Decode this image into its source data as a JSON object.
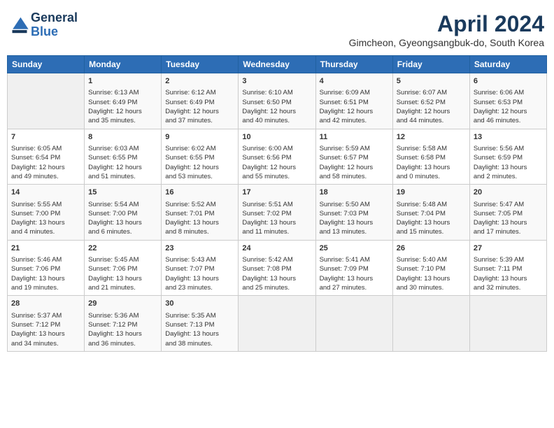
{
  "logo": {
    "line1": "General",
    "line2": "Blue"
  },
  "title": "April 2024",
  "subtitle": "Gimcheon, Gyeongsangbuk-do, South Korea",
  "days_of_week": [
    "Sunday",
    "Monday",
    "Tuesday",
    "Wednesday",
    "Thursday",
    "Friday",
    "Saturday"
  ],
  "weeks": [
    [
      {
        "day": "",
        "info": ""
      },
      {
        "day": "1",
        "info": "Sunrise: 6:13 AM\nSunset: 6:49 PM\nDaylight: 12 hours\nand 35 minutes."
      },
      {
        "day": "2",
        "info": "Sunrise: 6:12 AM\nSunset: 6:49 PM\nDaylight: 12 hours\nand 37 minutes."
      },
      {
        "day": "3",
        "info": "Sunrise: 6:10 AM\nSunset: 6:50 PM\nDaylight: 12 hours\nand 40 minutes."
      },
      {
        "day": "4",
        "info": "Sunrise: 6:09 AM\nSunset: 6:51 PM\nDaylight: 12 hours\nand 42 minutes."
      },
      {
        "day": "5",
        "info": "Sunrise: 6:07 AM\nSunset: 6:52 PM\nDaylight: 12 hours\nand 44 minutes."
      },
      {
        "day": "6",
        "info": "Sunrise: 6:06 AM\nSunset: 6:53 PM\nDaylight: 12 hours\nand 46 minutes."
      }
    ],
    [
      {
        "day": "7",
        "info": "Sunrise: 6:05 AM\nSunset: 6:54 PM\nDaylight: 12 hours\nand 49 minutes."
      },
      {
        "day": "8",
        "info": "Sunrise: 6:03 AM\nSunset: 6:55 PM\nDaylight: 12 hours\nand 51 minutes."
      },
      {
        "day": "9",
        "info": "Sunrise: 6:02 AM\nSunset: 6:55 PM\nDaylight: 12 hours\nand 53 minutes."
      },
      {
        "day": "10",
        "info": "Sunrise: 6:00 AM\nSunset: 6:56 PM\nDaylight: 12 hours\nand 55 minutes."
      },
      {
        "day": "11",
        "info": "Sunrise: 5:59 AM\nSunset: 6:57 PM\nDaylight: 12 hours\nand 58 minutes."
      },
      {
        "day": "12",
        "info": "Sunrise: 5:58 AM\nSunset: 6:58 PM\nDaylight: 13 hours\nand 0 minutes."
      },
      {
        "day": "13",
        "info": "Sunrise: 5:56 AM\nSunset: 6:59 PM\nDaylight: 13 hours\nand 2 minutes."
      }
    ],
    [
      {
        "day": "14",
        "info": "Sunrise: 5:55 AM\nSunset: 7:00 PM\nDaylight: 13 hours\nand 4 minutes."
      },
      {
        "day": "15",
        "info": "Sunrise: 5:54 AM\nSunset: 7:00 PM\nDaylight: 13 hours\nand 6 minutes."
      },
      {
        "day": "16",
        "info": "Sunrise: 5:52 AM\nSunset: 7:01 PM\nDaylight: 13 hours\nand 8 minutes."
      },
      {
        "day": "17",
        "info": "Sunrise: 5:51 AM\nSunset: 7:02 PM\nDaylight: 13 hours\nand 11 minutes."
      },
      {
        "day": "18",
        "info": "Sunrise: 5:50 AM\nSunset: 7:03 PM\nDaylight: 13 hours\nand 13 minutes."
      },
      {
        "day": "19",
        "info": "Sunrise: 5:48 AM\nSunset: 7:04 PM\nDaylight: 13 hours\nand 15 minutes."
      },
      {
        "day": "20",
        "info": "Sunrise: 5:47 AM\nSunset: 7:05 PM\nDaylight: 13 hours\nand 17 minutes."
      }
    ],
    [
      {
        "day": "21",
        "info": "Sunrise: 5:46 AM\nSunset: 7:06 PM\nDaylight: 13 hours\nand 19 minutes."
      },
      {
        "day": "22",
        "info": "Sunrise: 5:45 AM\nSunset: 7:06 PM\nDaylight: 13 hours\nand 21 minutes."
      },
      {
        "day": "23",
        "info": "Sunrise: 5:43 AM\nSunset: 7:07 PM\nDaylight: 13 hours\nand 23 minutes."
      },
      {
        "day": "24",
        "info": "Sunrise: 5:42 AM\nSunset: 7:08 PM\nDaylight: 13 hours\nand 25 minutes."
      },
      {
        "day": "25",
        "info": "Sunrise: 5:41 AM\nSunset: 7:09 PM\nDaylight: 13 hours\nand 27 minutes."
      },
      {
        "day": "26",
        "info": "Sunrise: 5:40 AM\nSunset: 7:10 PM\nDaylight: 13 hours\nand 30 minutes."
      },
      {
        "day": "27",
        "info": "Sunrise: 5:39 AM\nSunset: 7:11 PM\nDaylight: 13 hours\nand 32 minutes."
      }
    ],
    [
      {
        "day": "28",
        "info": "Sunrise: 5:37 AM\nSunset: 7:12 PM\nDaylight: 13 hours\nand 34 minutes."
      },
      {
        "day": "29",
        "info": "Sunrise: 5:36 AM\nSunset: 7:12 PM\nDaylight: 13 hours\nand 36 minutes."
      },
      {
        "day": "30",
        "info": "Sunrise: 5:35 AM\nSunset: 7:13 PM\nDaylight: 13 hours\nand 38 minutes."
      },
      {
        "day": "",
        "info": ""
      },
      {
        "day": "",
        "info": ""
      },
      {
        "day": "",
        "info": ""
      },
      {
        "day": "",
        "info": ""
      }
    ]
  ]
}
